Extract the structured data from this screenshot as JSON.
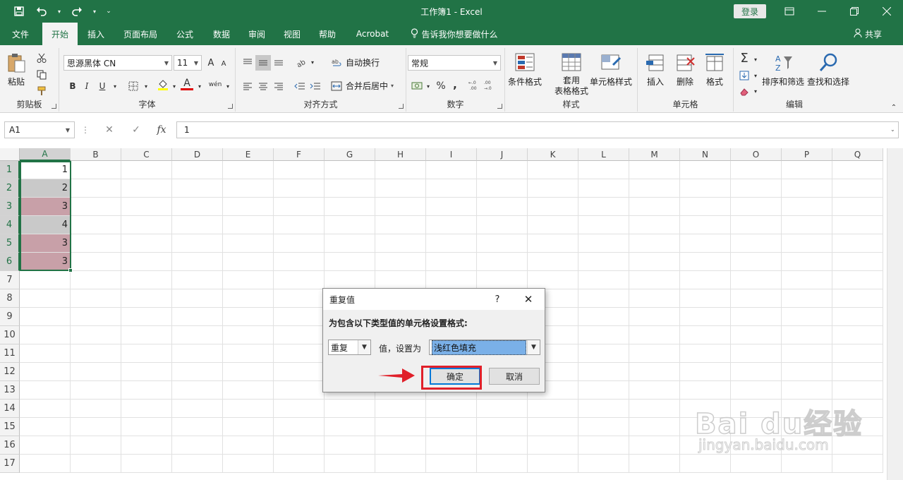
{
  "app": {
    "window_title": "工作簿1  -  Excel",
    "login_label": "登录",
    "share_label": "共享"
  },
  "tabs": [
    "文件",
    "开始",
    "插入",
    "页面布局",
    "公式",
    "数据",
    "审阅",
    "视图",
    "帮助",
    "Acrobat",
    "告诉我你想要做什么"
  ],
  "active_tab": "开始",
  "ribbon": {
    "clipboard": {
      "label": "剪贴板",
      "paste": "粘贴"
    },
    "font": {
      "label": "字体",
      "font_name": "思源黑体 CN",
      "font_size": "11",
      "bold": "B",
      "italic": "I",
      "underline": "U",
      "font_color_glyph": "A",
      "pinyin_glyph": "wén",
      "grow_glyph": "A",
      "shrink_glyph": "A"
    },
    "alignment": {
      "label": "对齐方式",
      "wrap_text": "自动换行",
      "merge_center": "合并后居中"
    },
    "number": {
      "label": "数字",
      "format": "常规",
      "percent": "%",
      "comma": ","
    },
    "styles": {
      "label": "样式",
      "conditional": "条件格式",
      "table_format_1": "套用",
      "table_format_2": "表格格式",
      "cell_styles": "单元格样式"
    },
    "cells": {
      "label": "单元格",
      "insert": "插入",
      "delete": "删除",
      "format": "格式"
    },
    "editing": {
      "label": "编辑",
      "sort_filter": "排序和筛选",
      "find_select": "查找和选择"
    }
  },
  "formula_bar": {
    "name_box": "A1",
    "fx": "fx",
    "value": "1"
  },
  "sheet": {
    "columns": [
      "A",
      "B",
      "C",
      "D",
      "E",
      "F",
      "G",
      "H",
      "I",
      "J",
      "K",
      "L",
      "M",
      "N",
      "O",
      "P",
      "Q"
    ],
    "rows": [
      "1",
      "2",
      "3",
      "4",
      "5",
      "6",
      "7",
      "8",
      "9",
      "10",
      "11",
      "12",
      "13",
      "14",
      "15",
      "16",
      "17"
    ],
    "column_a_values": [
      "1",
      "2",
      "3",
      "4",
      "3",
      "3"
    ],
    "column_a_fills": [
      "#ffffff",
      "#c9c9c9",
      "#c8a0a8",
      "#c9c9c9",
      "#c8a0a8",
      "#c8a0a8"
    ]
  },
  "dialog": {
    "title": "重复值",
    "help": "?",
    "prompt": "为包含以下类型值的单元格设置格式:",
    "rule_type": "重复",
    "middle_text": "值，设置为",
    "format_value": "浅红色填充",
    "ok_label": "确定",
    "cancel_label": "取消"
  },
  "watermark": {
    "brand": "Bai du经验",
    "url": "jingyan.baidu.com"
  },
  "colors": {
    "excel_green": "#217346",
    "annotation_red": "#e0202a",
    "duplicate_fill": "#c8a0a8"
  }
}
